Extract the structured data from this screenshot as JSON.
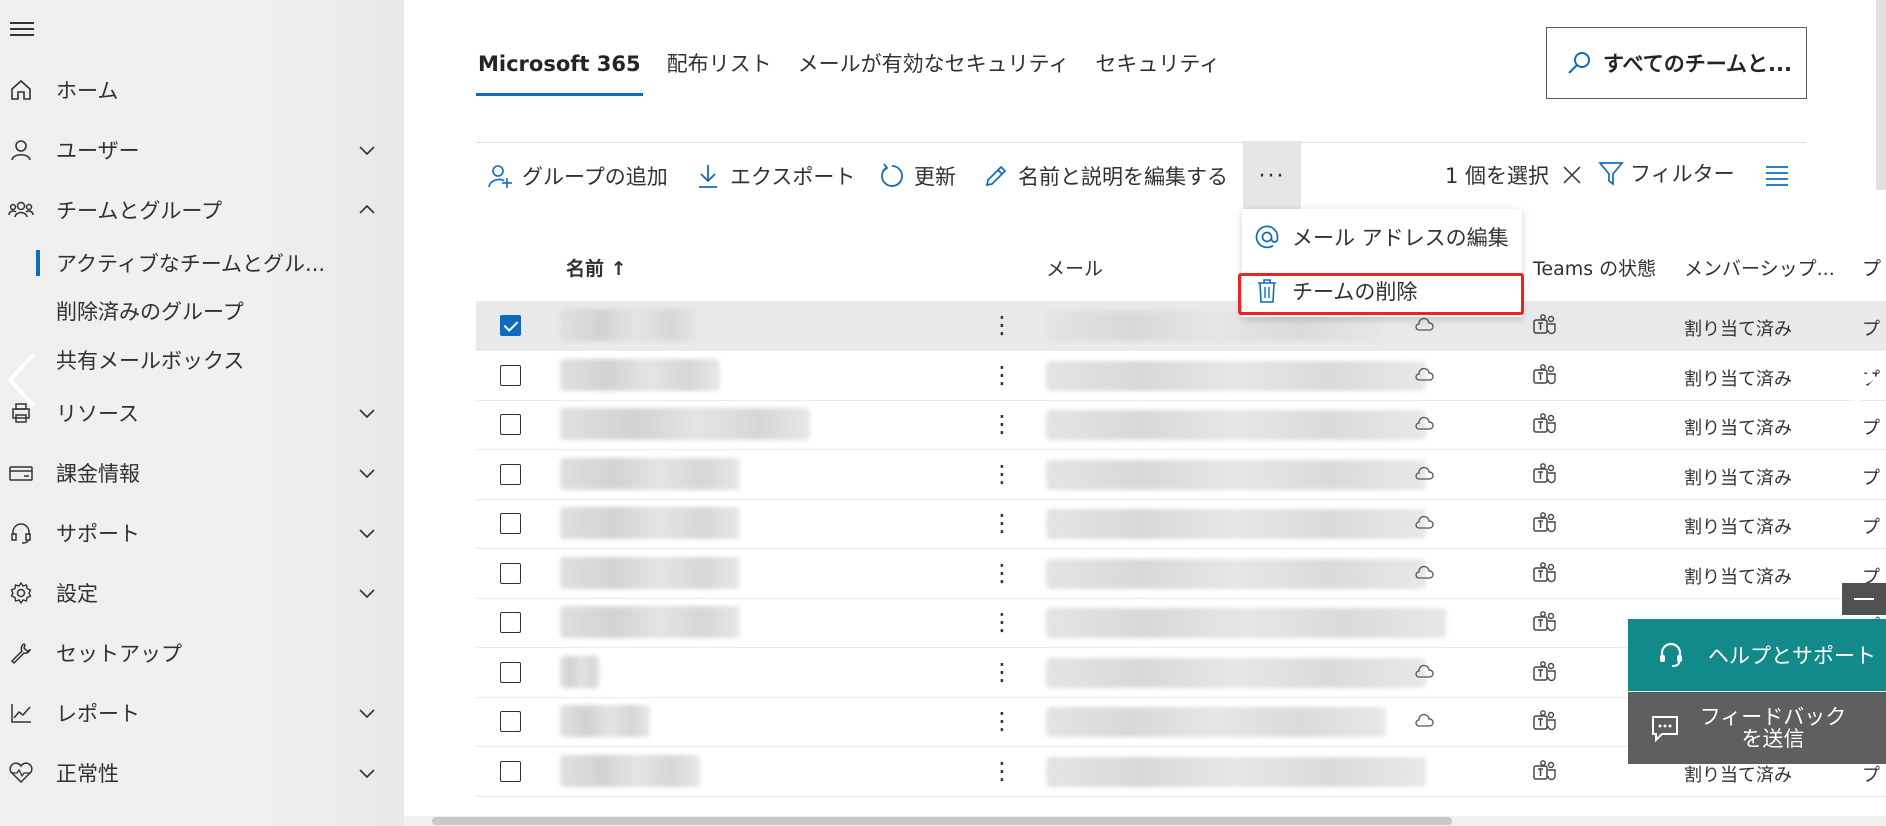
{
  "sidebar": {
    "items": [
      {
        "label": "ホーム",
        "icon": "home-icon",
        "chevron": ""
      },
      {
        "label": "ユーザー",
        "icon": "user-icon",
        "chevron": "down"
      },
      {
        "label": "チームとグループ",
        "icon": "people-icon",
        "chevron": "up"
      },
      {
        "label": "リソース",
        "icon": "printer-icon",
        "chevron": "down"
      },
      {
        "label": "課金情報",
        "icon": "card-icon",
        "chevron": "down"
      },
      {
        "label": "サポート",
        "icon": "headset-icon",
        "chevron": "down"
      },
      {
        "label": "設定",
        "icon": "gear-icon",
        "chevron": "down"
      },
      {
        "label": "セットアップ",
        "icon": "wrench-icon",
        "chevron": ""
      },
      {
        "label": "レポート",
        "icon": "chart-icon",
        "chevron": "down"
      },
      {
        "label": "正常性",
        "icon": "heart-icon",
        "chevron": "down"
      }
    ],
    "subitems": [
      "アクティブなチームとグル...",
      "削除済みのグループ",
      "共有メールボックス"
    ]
  },
  "tabs": [
    "Microsoft 365",
    "配布リスト",
    "メールが有効なセキュリティ",
    "セキュリティ"
  ],
  "search": {
    "label": "すべてのチームと..."
  },
  "toolbar": {
    "add_group": "グループの追加",
    "export": "エクスポート",
    "refresh": "更新",
    "edit_name": "名前と説明を編集する",
    "more": "···",
    "selected": "1 個を選択",
    "filter": "フィルター"
  },
  "dropdown": {
    "edit_email": "メール アドレスの編集",
    "delete_team": "チームの削除"
  },
  "table": {
    "headers": {
      "name": "名前 ↑",
      "mail": "メール",
      "teams": "Teams の状態",
      "membership": "メンバーシップ...",
      "extra": "プ"
    },
    "rows": [
      {
        "member": "割り当て済み",
        "selected": true,
        "cloud": true
      },
      {
        "member": "割り当て済み",
        "selected": false,
        "cloud": true
      },
      {
        "member": "割り当て済み",
        "selected": false,
        "cloud": true
      },
      {
        "member": "割り当て済み",
        "selected": false,
        "cloud": true
      },
      {
        "member": "割り当て済み",
        "selected": false,
        "cloud": true
      },
      {
        "member": "割り当て済み",
        "selected": false,
        "cloud": true
      },
      {
        "member": "",
        "selected": false,
        "cloud": false
      },
      {
        "member": "",
        "selected": false,
        "cloud": true
      },
      {
        "member": "",
        "selected": false,
        "cloud": true
      },
      {
        "member": "割り当て済み",
        "selected": false,
        "cloud": false
      }
    ],
    "row_extra": "プ"
  },
  "help": {
    "help_label": "ヘルプとサポート",
    "feedback_line1": "フィードバック",
    "feedback_line2": "を送信"
  },
  "colors": {
    "accent": "#0f6cbd",
    "help_bg": "#138a8a",
    "feedback_bg": "#5f5f5f",
    "highlight": "#ee2222"
  }
}
